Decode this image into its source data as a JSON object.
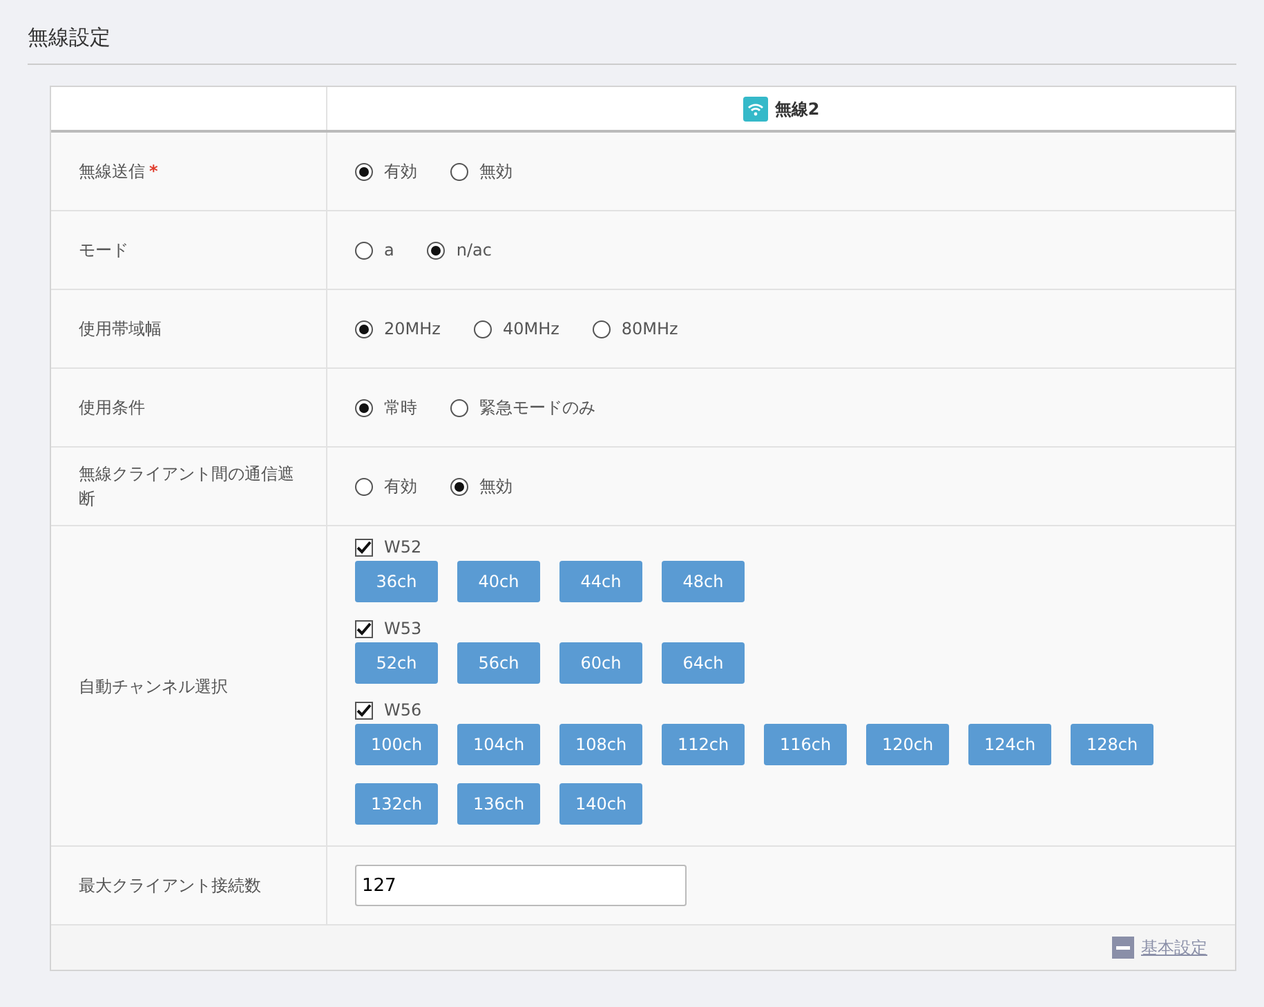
{
  "page_title": "無線設定",
  "table": {
    "header": {
      "label": "無線2"
    },
    "rows": [
      {
        "kind": "radio",
        "label": "無線送信",
        "required_mark": "*",
        "options": [
          {
            "label": "有効",
            "selected": true
          },
          {
            "label": "無効",
            "selected": false
          }
        ]
      },
      {
        "kind": "radio",
        "label": "モード",
        "options": [
          {
            "label": "a",
            "selected": false
          },
          {
            "label": "n/ac",
            "selected": true
          }
        ]
      },
      {
        "kind": "radio",
        "label": "使用帯域幅",
        "options": [
          {
            "label": "20MHz",
            "selected": true
          },
          {
            "label": "40MHz",
            "selected": false
          },
          {
            "label": "80MHz",
            "selected": false
          }
        ]
      },
      {
        "kind": "radio",
        "label": "使用条件",
        "options": [
          {
            "label": "常時",
            "selected": true
          },
          {
            "label": "緊急モードのみ",
            "selected": false
          }
        ]
      },
      {
        "kind": "radio",
        "label": "無線クライアント間の通信遮断",
        "options": [
          {
            "label": "有効",
            "selected": false
          },
          {
            "label": "無効",
            "selected": true
          }
        ]
      },
      {
        "kind": "channels",
        "label": "自動チャンネル選択",
        "groups": [
          {
            "label": "W52",
            "checked": true,
            "channels": [
              "36ch",
              "40ch",
              "44ch",
              "48ch"
            ]
          },
          {
            "label": "W53",
            "checked": true,
            "channels": [
              "52ch",
              "56ch",
              "60ch",
              "64ch"
            ]
          },
          {
            "label": "W56",
            "checked": true,
            "channels": [
              "100ch",
              "104ch",
              "108ch",
              "112ch",
              "116ch",
              "120ch",
              "124ch",
              "128ch",
              "132ch",
              "136ch",
              "140ch"
            ]
          }
        ]
      },
      {
        "kind": "input",
        "label": "最大クライアント接続数",
        "value": "127"
      }
    ]
  },
  "footer_link": "基本設定"
}
